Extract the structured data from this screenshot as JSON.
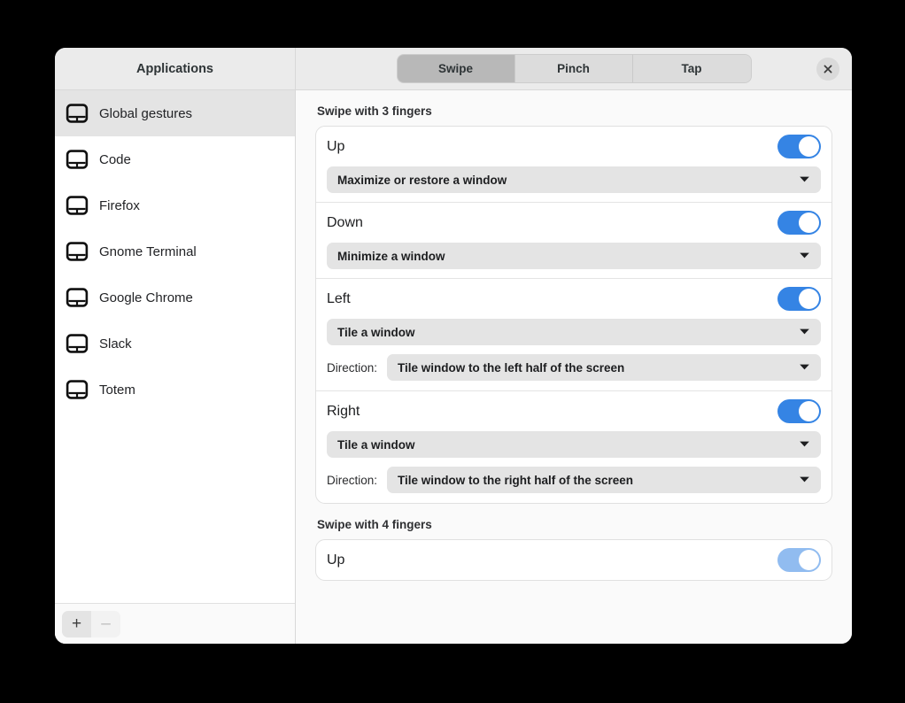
{
  "window": {
    "close_label": "×",
    "accent_color": "#3584e4",
    "accent_pale_color": "#91bcf0"
  },
  "sidebar": {
    "header_title": "Applications",
    "items": [
      {
        "label": "Global gestures",
        "icon": "touchpad-icon",
        "selected": true
      },
      {
        "label": "Code",
        "icon": "touchpad-icon",
        "selected": false
      },
      {
        "label": "Firefox",
        "icon": "touchpad-icon",
        "selected": false
      },
      {
        "label": "Gnome Terminal",
        "icon": "touchpad-icon",
        "selected": false
      },
      {
        "label": "Google Chrome",
        "icon": "touchpad-icon",
        "selected": false
      },
      {
        "label": "Slack",
        "icon": "touchpad-icon",
        "selected": false
      },
      {
        "label": "Totem",
        "icon": "touchpad-icon",
        "selected": false
      }
    ],
    "footer": {
      "add_label": "+",
      "add_icon": "plus-icon",
      "remove_label": "–",
      "remove_icon": "minus-icon"
    }
  },
  "tabs": [
    {
      "label": "Swipe",
      "selected": true
    },
    {
      "label": "Pinch",
      "selected": false
    },
    {
      "label": "Tap",
      "selected": false
    }
  ],
  "groups": [
    {
      "title": "Swipe with 3 fingers",
      "rows": [
        {
          "name": "up",
          "title": "Up",
          "enabled": true,
          "toggle_state": "on",
          "action": "Maximize or restore a window",
          "direction_label": null,
          "direction_value": null
        },
        {
          "name": "down",
          "title": "Down",
          "enabled": true,
          "toggle_state": "on",
          "action": "Minimize a window",
          "direction_label": null,
          "direction_value": null
        },
        {
          "name": "left",
          "title": "Left",
          "enabled": true,
          "toggle_state": "on",
          "action": "Tile a window",
          "direction_label": "Direction:",
          "direction_value": "Tile window to the left half of the screen"
        },
        {
          "name": "right",
          "title": "Right",
          "enabled": true,
          "toggle_state": "on",
          "action": "Tile a window",
          "direction_label": "Direction:",
          "direction_value": "Tile window to the right half of the screen"
        }
      ]
    },
    {
      "title": "Swipe with 4 fingers",
      "rows": [
        {
          "name": "up",
          "title": "Up",
          "enabled": true,
          "toggle_state": "on-pale",
          "action": null,
          "direction_label": null,
          "direction_value": null
        }
      ]
    }
  ]
}
